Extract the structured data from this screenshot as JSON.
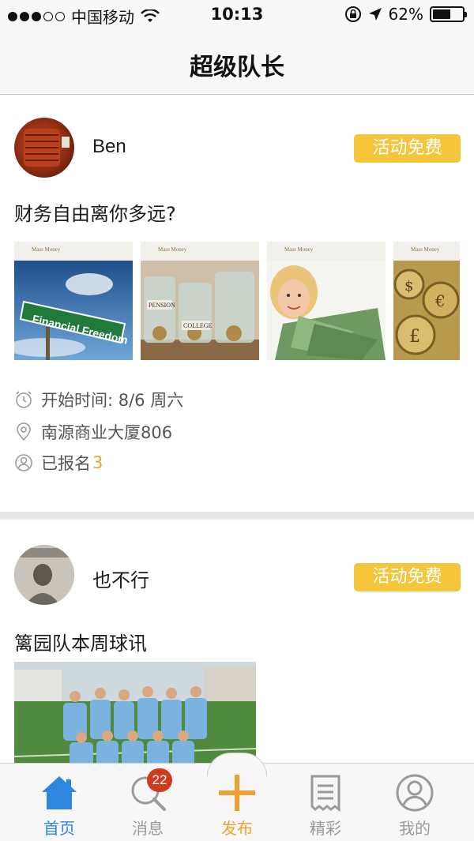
{
  "status_bar": {
    "carrier": "中国移动",
    "time": "10:13",
    "battery": "62%",
    "battery_level": 0.62,
    "signal_bars_filled": 3,
    "signal_bars_total": 5
  },
  "nav": {
    "title": "超级队长"
  },
  "posts": [
    {
      "username": "Ben",
      "badge": "活动免费",
      "title": "财务自由离你多远?",
      "thumbnails": [
        {
          "label": "Financial Freedom"
        },
        {
          "label": "PENSION COLLEGE"
        },
        {
          "label": ""
        },
        {
          "label": ""
        }
      ],
      "start_time_label": "开始时间: 8/6 周六",
      "location": "南源商业大厦806",
      "signed_up_label": "已报名",
      "signed_up_count": "3"
    },
    {
      "username": "也不行",
      "badge": "活动免费",
      "title": "篱园队本周球讯"
    }
  ],
  "tab_bar": {
    "items": [
      {
        "label": "首页",
        "icon": "home-icon",
        "active": true
      },
      {
        "label": "消息",
        "icon": "message-search-icon",
        "badge": "22"
      },
      {
        "label": "发布",
        "icon": "plus-icon"
      },
      {
        "label": "精彩",
        "icon": "receipt-icon"
      },
      {
        "label": "我的",
        "icon": "user-icon"
      }
    ]
  },
  "colors": {
    "badge": "#f5c53c",
    "active_tab": "#2e86de",
    "publish": "#f0a030",
    "notification": "#d03a1f"
  }
}
